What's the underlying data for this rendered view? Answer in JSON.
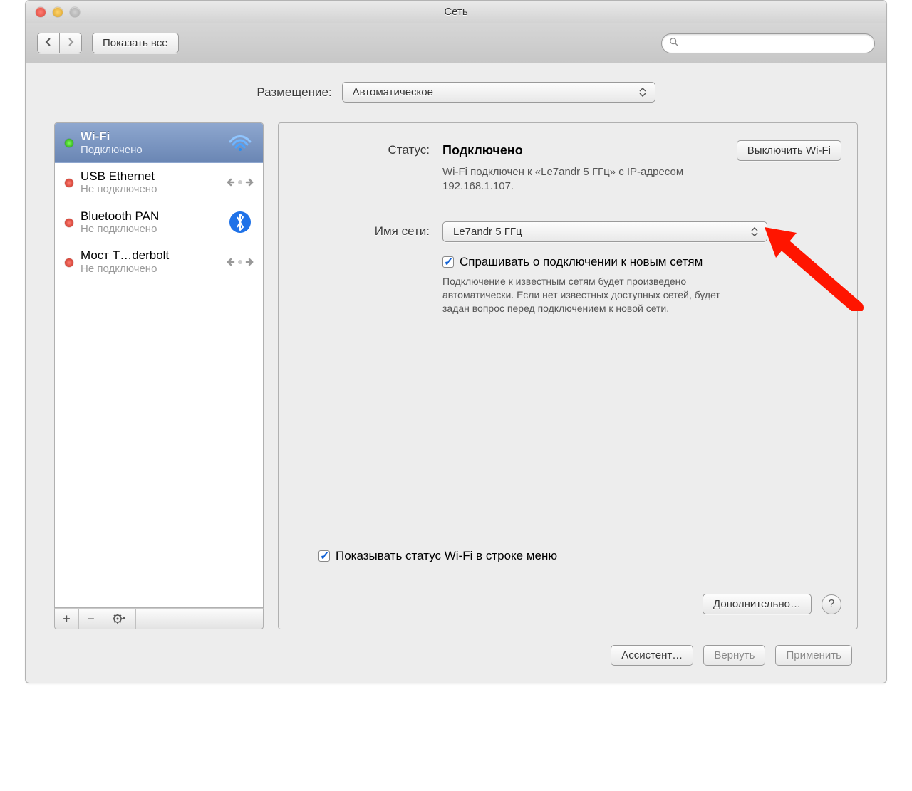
{
  "window": {
    "title": "Сеть"
  },
  "toolbar": {
    "show_all": "Показать все",
    "search_placeholder": ""
  },
  "location": {
    "label": "Размещение:",
    "value": "Автоматическое"
  },
  "sidebar": {
    "items": [
      {
        "name": "Wi-Fi",
        "sub": "Подключено",
        "status": "green",
        "icon": "wifi",
        "selected": true
      },
      {
        "name": "USB Ethernet",
        "sub": "Не подключено",
        "status": "red",
        "icon": "ethernet",
        "selected": false
      },
      {
        "name": "Bluetooth PAN",
        "sub": "Не подключено",
        "status": "red",
        "icon": "bluetooth",
        "selected": false
      },
      {
        "name": "Мост T…derbolt",
        "sub": "Не подключено",
        "status": "red",
        "icon": "ethernet",
        "selected": false
      }
    ],
    "footer_icons": {
      "add": "+",
      "remove": "−",
      "gear": ""
    }
  },
  "detail": {
    "status_label": "Статус:",
    "status_value": "Подключено",
    "toggle_wifi": "Выключить Wi-Fi",
    "status_desc": "Wi-Fi подключен к «Le7andr 5 ГГц» с IP-адресом 192.168.1.107.",
    "network_label": "Имя сети:",
    "network_value": "Le7andr 5 ГГц",
    "ask_join_label": "Спрашивать о подключении к новым сетям",
    "ask_join_help": "Подключение к известным сетям будет произведено автоматически. Если нет известных доступных сетей, будет задан вопрос перед подключением к новой сети.",
    "show_status_label": "Показывать статус Wi-Fi в строке меню",
    "advanced": "Дополнительно…",
    "help": "?"
  },
  "footer": {
    "assistant": "Ассистент…",
    "revert": "Вернуть",
    "apply": "Применить"
  }
}
